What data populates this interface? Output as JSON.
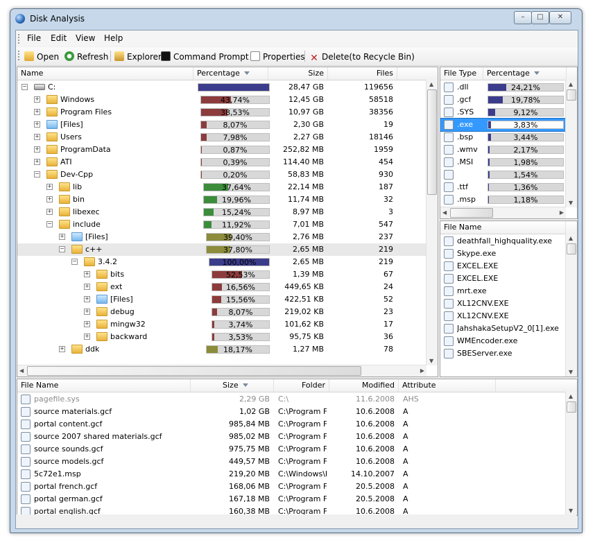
{
  "window": {
    "title": "Disk Analysis",
    "minimize": "–",
    "maximize": "□",
    "close": "✕"
  },
  "menu": [
    "File",
    "Edit",
    "View",
    "Help"
  ],
  "toolbar": [
    {
      "label": "Open",
      "icon": "open-folder-icon"
    },
    {
      "label": "Refresh",
      "icon": "refresh-icon"
    },
    {
      "label": "Explorer",
      "icon": "explorer-icon"
    },
    {
      "label": "Command Prompt",
      "icon": "command-prompt-icon"
    },
    {
      "label": "Properties",
      "icon": "properties-icon"
    },
    {
      "label": "Delete(to Recycle Bin)",
      "icon": "delete-icon"
    }
  ],
  "tree": {
    "columns": {
      "name": "Name",
      "percentage": "Percentage",
      "size": "Size",
      "files": "Files"
    },
    "rows": [
      {
        "name": "C:",
        "depth": 0,
        "type": "drive",
        "expander": "minus",
        "pct": 100,
        "pct_label": "",
        "size": "28,47 GB",
        "files": "119656",
        "color": "#3c3c8c"
      },
      {
        "name": "Windows",
        "depth": 1,
        "type": "folder",
        "expander": "plus",
        "pct": 43.74,
        "pct_label": "43,74%",
        "size": "12,45 GB",
        "files": "58518",
        "color": "#8c3c3c"
      },
      {
        "name": "Program Files",
        "depth": 1,
        "type": "folder",
        "expander": "plus",
        "pct": 38.53,
        "pct_label": "38,53%",
        "size": "10,97 GB",
        "files": "38356",
        "color": "#8c3c3c"
      },
      {
        "name": "[Files]",
        "depth": 1,
        "type": "blue",
        "expander": "plus",
        "pct": 8.07,
        "pct_label": "8,07%",
        "size": "2,30 GB",
        "files": "19",
        "color": "#8c3c3c"
      },
      {
        "name": "Users",
        "depth": 1,
        "type": "folder",
        "expander": "plus",
        "pct": 7.98,
        "pct_label": "7,98%",
        "size": "2,27 GB",
        "files": "18146",
        "color": "#8c3c3c"
      },
      {
        "name": "ProgramData",
        "depth": 1,
        "type": "folder",
        "expander": "plus",
        "pct": 0.87,
        "pct_label": "0,87%",
        "size": "252,82 MB",
        "files": "1959",
        "color": "#8c3c3c"
      },
      {
        "name": "ATI",
        "depth": 1,
        "type": "folder",
        "expander": "plus",
        "pct": 0.39,
        "pct_label": "0,39%",
        "size": "114,40 MB",
        "files": "454",
        "color": "#8c3c3c"
      },
      {
        "name": "Dev-Cpp",
        "depth": 1,
        "type": "folder",
        "expander": "minus",
        "pct": 0.2,
        "pct_label": "0,20%",
        "size": "58,83 MB",
        "files": "930",
        "color": "#8c3c3c"
      },
      {
        "name": "lib",
        "depth": 2,
        "type": "folder",
        "expander": "plus",
        "pct": 37.64,
        "pct_label": "37,64%",
        "size": "22,14 MB",
        "files": "187",
        "color": "#3c8c3c"
      },
      {
        "name": "bin",
        "depth": 2,
        "type": "folder",
        "expander": "plus",
        "pct": 19.96,
        "pct_label": "19,96%",
        "size": "11,74 MB",
        "files": "32",
        "color": "#3c8c3c"
      },
      {
        "name": "libexec",
        "depth": 2,
        "type": "folder",
        "expander": "plus",
        "pct": 15.24,
        "pct_label": "15,24%",
        "size": "8,97 MB",
        "files": "3",
        "color": "#3c8c3c"
      },
      {
        "name": "include",
        "depth": 2,
        "type": "folder",
        "expander": "minus",
        "pct": 11.92,
        "pct_label": "11,92%",
        "size": "7,01 MB",
        "files": "547",
        "color": "#3c8c3c"
      },
      {
        "name": "[Files]",
        "depth": 3,
        "type": "blue",
        "expander": "plus",
        "pct": 39.4,
        "pct_label": "39,40%",
        "size": "2,76 MB",
        "files": "237",
        "color": "#8c8c3c"
      },
      {
        "name": "c++",
        "depth": 3,
        "type": "folder",
        "expander": "minus",
        "pct": 37.8,
        "pct_label": "37,80%",
        "size": "2,65 MB",
        "files": "219",
        "color": "#8c8c3c",
        "selected": true
      },
      {
        "name": "3.4.2",
        "depth": 4,
        "type": "folder",
        "expander": "minus",
        "pct": 100,
        "pct_label": "100,00%",
        "size": "2,65 MB",
        "files": "219",
        "color": "#3c3c8c"
      },
      {
        "name": "bits",
        "depth": 5,
        "type": "folder",
        "expander": "plus",
        "pct": 52.53,
        "pct_label": "52,53%",
        "size": "1,39 MB",
        "files": "67",
        "color": "#8c3c3c"
      },
      {
        "name": "ext",
        "depth": 5,
        "type": "folder",
        "expander": "plus",
        "pct": 16.56,
        "pct_label": "16,56%",
        "size": "449,65 KB",
        "files": "24",
        "color": "#8c3c3c"
      },
      {
        "name": "[Files]",
        "depth": 5,
        "type": "blue",
        "expander": "plus",
        "pct": 15.56,
        "pct_label": "15,56%",
        "size": "422,51 KB",
        "files": "52",
        "color": "#8c3c3c"
      },
      {
        "name": "debug",
        "depth": 5,
        "type": "folder",
        "expander": "plus",
        "pct": 8.07,
        "pct_label": "8,07%",
        "size": "219,02 KB",
        "files": "23",
        "color": "#8c3c3c"
      },
      {
        "name": "mingw32",
        "depth": 5,
        "type": "folder",
        "expander": "plus",
        "pct": 3.74,
        "pct_label": "3,74%",
        "size": "101,62 KB",
        "files": "17",
        "color": "#8c3c3c"
      },
      {
        "name": "backward",
        "depth": 5,
        "type": "folder",
        "expander": "plus",
        "pct": 3.53,
        "pct_label": "3,53%",
        "size": "95,75 KB",
        "files": "36",
        "color": "#8c3c3c"
      },
      {
        "name": "ddk",
        "depth": 3,
        "type": "folder",
        "expander": "plus",
        "pct": 18.17,
        "pct_label": "18,17%",
        "size": "1,27 MB",
        "files": "78",
        "color": "#8c8c3c"
      }
    ]
  },
  "types": {
    "columns": {
      "type": "File Type",
      "percentage": "Percentage"
    },
    "rows": [
      {
        "ext": ".dll",
        "pct": 24.21,
        "pct_label": "24,21%",
        "icon": "dll-file-icon"
      },
      {
        "ext": ".gcf",
        "pct": 19.78,
        "pct_label": "19,78%",
        "icon": "gcf-file-icon"
      },
      {
        "ext": ".SYS",
        "pct": 9.12,
        "pct_label": "9,12%",
        "icon": "sys-file-icon"
      },
      {
        "ext": ".exe",
        "pct": 3.83,
        "pct_label": "3,83%",
        "icon": "exe-file-icon",
        "selected": true
      },
      {
        "ext": ".bsp",
        "pct": 3.44,
        "pct_label": "3,44%",
        "icon": "bsp-file-icon"
      },
      {
        "ext": ".wmv",
        "pct": 2.17,
        "pct_label": "2,17%",
        "icon": "wmv-file-icon"
      },
      {
        "ext": ".MSI",
        "pct": 1.98,
        "pct_label": "1,98%",
        "icon": "msi-file-icon"
      },
      {
        "ext": "",
        "pct": 1.54,
        "pct_label": "1,54%",
        "icon": "blank-file-icon"
      },
      {
        "ext": ".ttf",
        "pct": 1.36,
        "pct_label": "1,36%",
        "icon": "font-file-icon"
      },
      {
        "ext": ".msp",
        "pct": 1.18,
        "pct_label": "1,18%",
        "icon": "msp-file-icon"
      }
    ],
    "bar_color": "#3c3c8c"
  },
  "names": {
    "column": "File Name",
    "rows": [
      {
        "name": "deathfall_highquality.exe",
        "icon": "7zip-icon"
      },
      {
        "name": "Skype.exe",
        "icon": "skype-icon"
      },
      {
        "name": "EXCEL.EXE",
        "icon": "excel-icon"
      },
      {
        "name": "EXCEL.EXE",
        "icon": "excel-icon"
      },
      {
        "name": "mrt.exe",
        "icon": "mrt-icon"
      },
      {
        "name": "XL12CNV.EXE",
        "icon": "excel-icon"
      },
      {
        "name": "XL12CNV.EXE",
        "icon": "excel-icon"
      },
      {
        "name": "JahshakaSetupV2_0[1].exe",
        "icon": "installer-icon"
      },
      {
        "name": "WMEncoder.exe",
        "icon": "encoder-icon"
      },
      {
        "name": "SBEServer.exe",
        "icon": "exe-file-icon"
      }
    ]
  },
  "files": {
    "columns": {
      "name": "File Name",
      "size": "Size",
      "folder": "Folder",
      "modified": "Modified",
      "attribute": "Attribute"
    },
    "rows": [
      {
        "name": "pagefile.sys",
        "size": "2,29 GB",
        "folder": "C:\\",
        "modified": "11.6.2008",
        "attr": "AHS",
        "gray": true,
        "icon": "system-file-icon"
      },
      {
        "name": "source materials.gcf",
        "size": "1,02 GB",
        "folder": "C:\\Program Fil",
        "modified": "10.6.2008",
        "attr": "A",
        "icon": "gcf-file-icon"
      },
      {
        "name": "portal content.gcf",
        "size": "985,84 MB",
        "folder": "C:\\Program Fil",
        "modified": "10.6.2008",
        "attr": "A",
        "icon": "gcf-file-icon"
      },
      {
        "name": "source 2007 shared materials.gcf",
        "size": "985,02 MB",
        "folder": "C:\\Program Fil",
        "modified": "10.6.2008",
        "attr": "A",
        "icon": "gcf-file-icon"
      },
      {
        "name": "source sounds.gcf",
        "size": "975,75 MB",
        "folder": "C:\\Program Fil",
        "modified": "10.6.2008",
        "attr": "A",
        "icon": "gcf-file-icon"
      },
      {
        "name": "source models.gcf",
        "size": "449,57 MB",
        "folder": "C:\\Program Fil",
        "modified": "10.6.2008",
        "attr": "A",
        "icon": "gcf-file-icon"
      },
      {
        "name": "5c72e1.msp",
        "size": "219,20 MB",
        "folder": "C:\\Windows\\I",
        "modified": "14.10.2007",
        "attr": "A",
        "icon": "msp-file-icon"
      },
      {
        "name": "portal french.gcf",
        "size": "168,06 MB",
        "folder": "C:\\Program Fil",
        "modified": "20.5.2008",
        "attr": "A",
        "icon": "gcf-file-icon"
      },
      {
        "name": "portal german.gcf",
        "size": "167,18 MB",
        "folder": "C:\\Program Fil",
        "modified": "20.5.2008",
        "attr": "A",
        "icon": "gcf-file-icon"
      },
      {
        "name": "portal english.gcf",
        "size": "160,38 MB",
        "folder": "C:\\Program Fil",
        "modified": "10.6.2008",
        "attr": "A",
        "icon": "gcf-file-icon"
      }
    ]
  }
}
